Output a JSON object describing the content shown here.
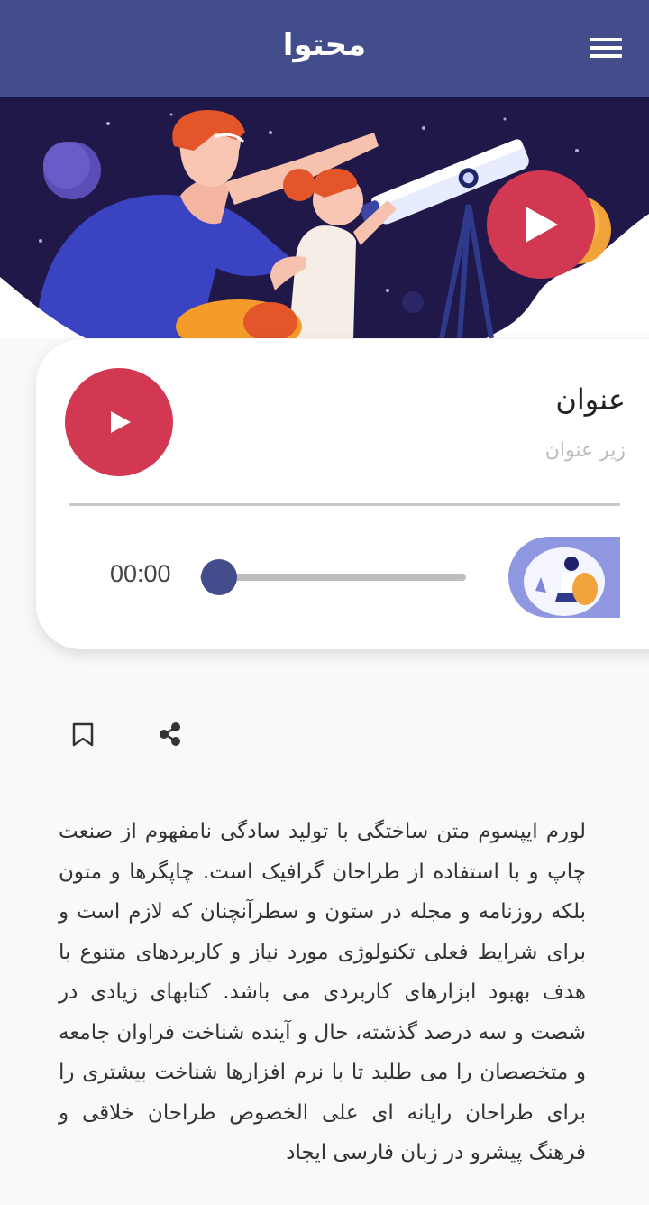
{
  "header": {
    "title": "محتوا",
    "menu_icon": "hamburger-menu-icon",
    "background": "#444d8c"
  },
  "hero": {
    "illustration": "father-daughter-telescope-space",
    "play_icon": "play-icon"
  },
  "player": {
    "title": "عنوان",
    "subtitle": "زیر عنوان",
    "current_time": "00:00",
    "progress": 0,
    "play_icon": "play-icon",
    "accent_color": "#d23852",
    "thumb_color": "#444d8c",
    "artwork": "woman-reading-illustration"
  },
  "actions": {
    "share_icon": "share-icon",
    "bookmark_icon": "bookmark-icon"
  },
  "content": {
    "body": "لورم ایپسوم متن ساختگی با تولید سادگی نامفهوم از صنعت چاپ و با استفاده از طراحان گرافیک است. چاپگرها و متون بلکه روزنامه و مجله در ستون و سطرآنچنان که لازم است و برای شرایط فعلی تکنولوژی مورد نیاز و کاربردهای متنوع با هدف بهبود ابزارهای کاربردی می باشد. کتابهای زیادی در شصت و سه درصد گذشته، حال و آینده شناخت فراوان جامعه و متخصصان را می طلبد تا با نرم افزارها شناخت بیشتری را برای طراحان رایانه ای علی الخصوص طراحان خلاقی و فرهنگ پیشرو در زبان فارسی ایجاد"
  }
}
